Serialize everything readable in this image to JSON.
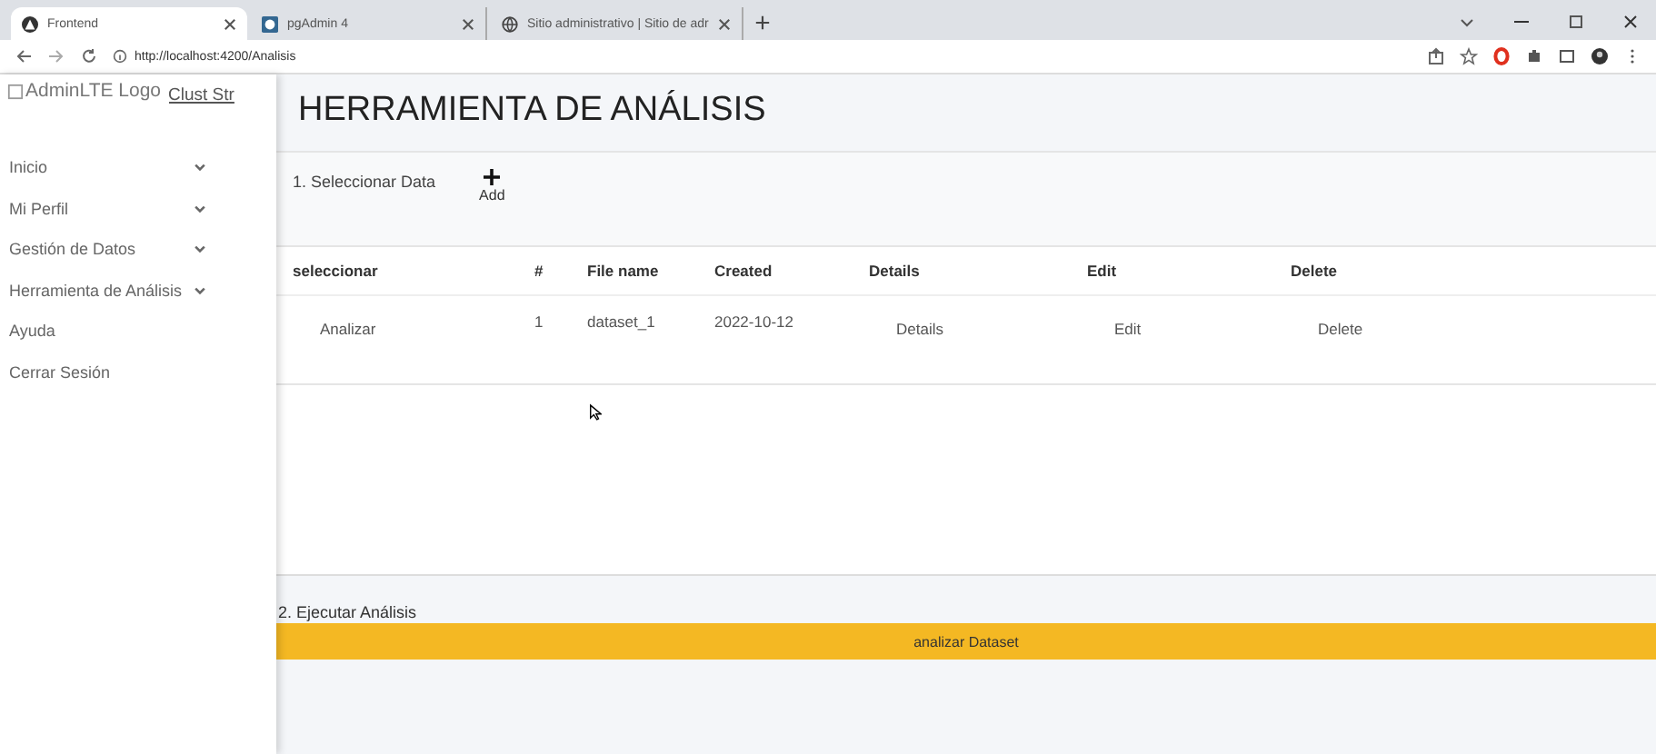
{
  "browser": {
    "tabs": [
      {
        "label": "Frontend",
        "selected": true,
        "kind": "app"
      },
      {
        "label": "pgAdmin 4",
        "selected": false,
        "kind": "pg"
      },
      {
        "label": "Sitio administrativo | Sitio de adr",
        "selected": false,
        "kind": "globe"
      }
    ],
    "address": "http://localhost:4200/Analisis"
  },
  "sidebar": {
    "logo_alt": "AdminLTE Logo",
    "brand": "Clust Str",
    "items": [
      {
        "label": "Inicio",
        "kind": "dropdown"
      },
      {
        "label": "Mi Perfil",
        "kind": "dropdown"
      },
      {
        "label": "Gestión de Datos",
        "kind": "dropdown"
      },
      {
        "label": "Herramienta de Análisis",
        "kind": "dropdown"
      },
      {
        "label": "Ayuda",
        "kind": "link"
      },
      {
        "label": "Cerrar Sesión",
        "kind": "link"
      }
    ]
  },
  "page_title": "HERRAMIENTA DE ANÁLISIS",
  "step1": {
    "label": "1. Seleccionar Data",
    "add_button": "Add"
  },
  "table": {
    "columns": [
      "seleccionar",
      "#",
      "File name",
      "Created",
      "Details",
      "Edit",
      "Delete"
    ],
    "rows": [
      {
        "select": "Analizar",
        "index": "1",
        "file_name": "dataset_1",
        "created": "2022-10-12",
        "details": "Details",
        "edit": "Edit",
        "delete": "Delete"
      }
    ]
  },
  "step2": {
    "label": "2. Ejecutar Análisis",
    "button": "analizar Dataset"
  }
}
